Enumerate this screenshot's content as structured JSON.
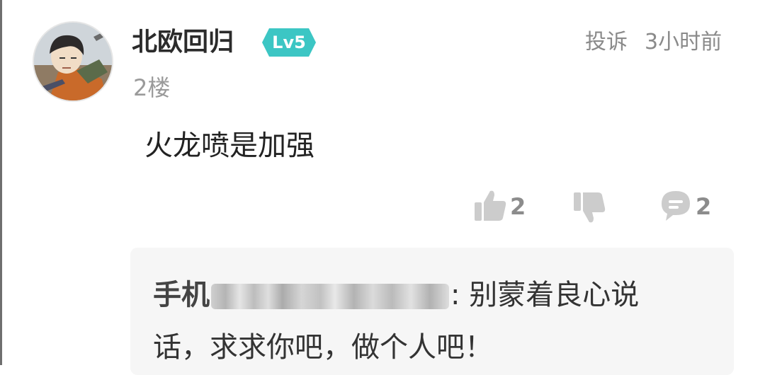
{
  "comment": {
    "username": "北欧回归",
    "level": "Lv5",
    "report_label": "投诉",
    "time": "3小时前",
    "floor": "2楼",
    "text": "火龙喷是加强",
    "likes": "2",
    "replies": "2",
    "colors": {
      "level_badge": "#3cc6c4",
      "meta_text": "#8a8a8a",
      "action_icon": "#cccccc"
    }
  },
  "reply": {
    "author_visible": "手机",
    "author_tail": ":",
    "text_line1": "别蒙着良心说",
    "text_line2": "话，求求你吧，做个人吧！"
  }
}
